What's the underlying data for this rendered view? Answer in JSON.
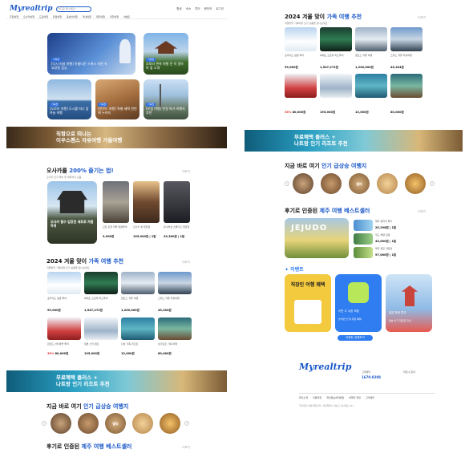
{
  "colors": {
    "brand": "#1b59c9",
    "accent": "#2f6fe0",
    "event_bg": "#2f7df0"
  },
  "header": {
    "logo": "Myrealtrip",
    "search_placeholder": "어디로 떠나세요?",
    "nav": [
      "항공",
      "숙소",
      "투어",
      "렌터카",
      "로그인"
    ],
    "categories": [
      "추천여행",
      "오사카여행",
      "도쿄여행",
      "유럽여행",
      "동남아여행",
      "국내여행",
      "제주여행",
      "미주여행",
      "이벤트"
    ]
  },
  "hero": [
    {
      "title": "[다시 떠날 여행] 아름다운 스위스 자연 속 요양원 감상",
      "tag": "기획전"
    },
    {
      "title": "오로라 관측 여행 전 꼭 알아야 할 소개",
      "tag": "기획전"
    },
    {
      "title": "[오로라 여행] 도시를 떠나 밤하늘 여행",
      "tag": "기획전"
    },
    {
      "title": "[핀란드 여행] 특별 혜택 한번에 누리자",
      "tag": "기획전"
    },
    {
      "title": "[유럽 여행] 한정 특가 여행지 추천",
      "tag": "기획전"
    }
  ],
  "banner1": {
    "line1": "직항으로 떠나는",
    "line2": "이우스펜스 자유여행 가을여행"
  },
  "osaka": {
    "title_pre": "오사카를 ",
    "title_hl": "200% 즐기는 법!",
    "subtitle": "오사카 인기 투어 및 액티비티 모음",
    "more": "더보기",
    "feature": "오사카 필수 입장권 세트로 저렴하게",
    "items": [
      {
        "name": "교토 온천 마을 일일투어",
        "price": "9,900원"
      },
      {
        "name": "오사카 성 입장권",
        "price": "105,000원 | 1일"
      },
      {
        "name": "유니버설 스튜디오 입장권",
        "price": "29,300원 | 1일"
      }
    ]
  },
  "family": {
    "title_pre": "2024 겨울 맞이 ",
    "title_hl": "가족 여행 추천",
    "subtitle": "겨울방학 가족여행 인기 상품을 만나보세요",
    "more": "더보기",
    "items": [
      {
        "name": "홋카이도 설경 투어",
        "price": "99,000원"
      },
      {
        "name": "북해도 오로라 버스투어",
        "price": "1,547,272원"
      },
      {
        "name": "알프스 겨울 여행",
        "price": "1,200,000원"
      },
      {
        "name": "스위스 겨울 자유여행",
        "price": "45,204원"
      },
      {
        "name": "핀란드 산타마을 투어",
        "price": "80,000원",
        "discount": "36%"
      },
      {
        "name": "일본 스키 캠프",
        "price": "195,000원"
      },
      {
        "name": "다낭 가족 리조트",
        "price": "13,000원"
      },
      {
        "name": "싱가포르 가족 여행",
        "price": "80,000원"
      }
    ]
  },
  "banner2": {
    "line1": "무료혜택 플러스 +",
    "line2": "나트랑 인기 리조트 추천"
  },
  "hot": {
    "title_pre": "지금 바로 여기 ",
    "title_hl": "인기 급상승 여행지",
    "places": [
      "도쿄",
      "파리",
      "발리",
      "이집트",
      "방콕"
    ]
  },
  "jeju": {
    "title_pre": "후기로 인증된 ",
    "title_hl": "제주 여행 베스트셀러",
    "more": "더보기",
    "feature": "JEJUDO",
    "items": [
      {
        "name": "제주 렌터카 특가",
        "price": "25,298원 | 1일"
      },
      {
        "name": "우도 해양 관광",
        "price": "43,000원 | 1일"
      },
      {
        "name": "제주 골프 라운딩",
        "price": "97,000원 | 1일"
      }
    ]
  },
  "events": {
    "title": "이벤트",
    "cards": [
      {
        "title": "직장인 여행 혜택",
        "text": "직장인을 위한 특별 할인"
      },
      {
        "title": "이번 주 쿠폰 모음",
        "text": "놓치면 안 될 쿠폰 혜택"
      },
      {
        "title": "일본 한정 특가",
        "text": "일본 인기 항공권 할인"
      }
    ],
    "button": "이벤트 전체보기"
  },
  "footer": {
    "logo": "Myrealtrip",
    "links": [
      "회사소개",
      "이용약관",
      "개인정보처리방침",
      "여행자 약관",
      "고객센터"
    ],
    "cs_title": "고객센터",
    "cs_phone": "1670-8208",
    "partner": "파트너 문의",
    "corp": "주식회사 마이리얼트립 | 서울특별시 서초구 강남대로 311"
  }
}
